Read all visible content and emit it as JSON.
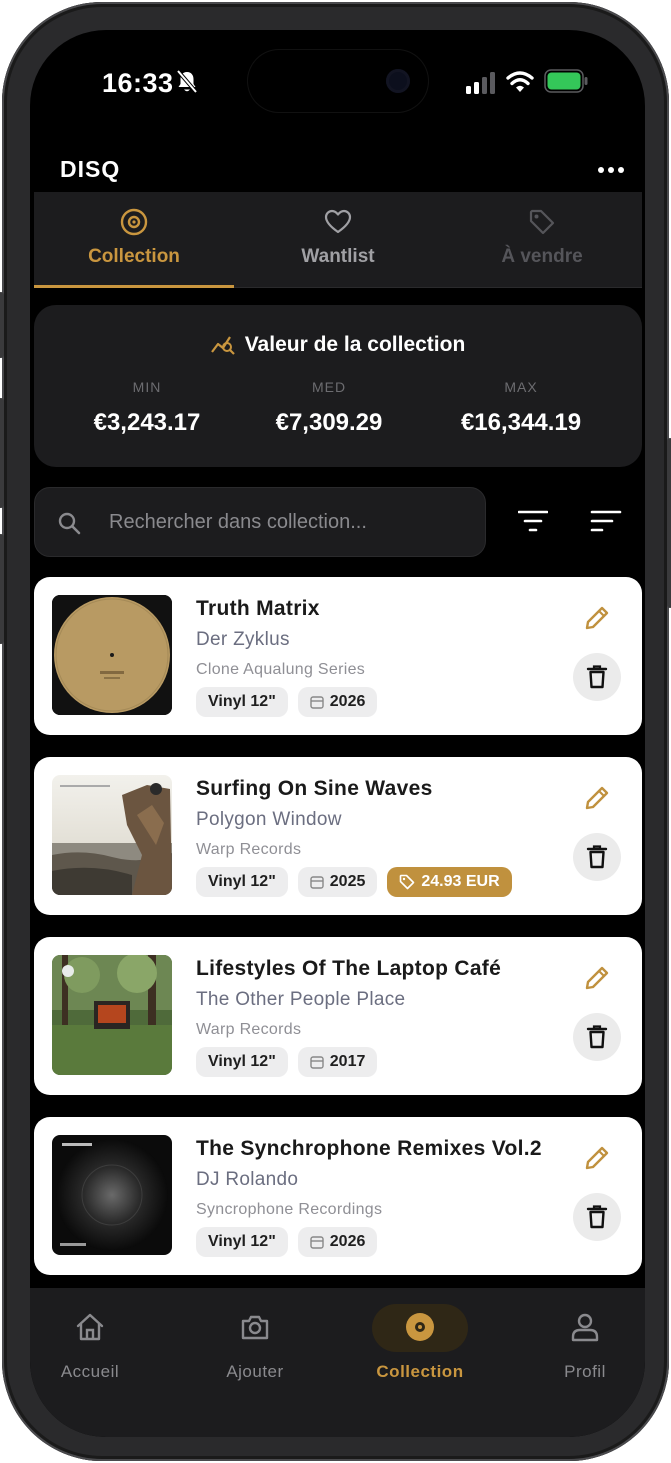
{
  "status_bar": {
    "time": "16:33"
  },
  "header": {
    "title": "DISQ"
  },
  "tabs": [
    {
      "label": "Collection",
      "icon": "vinyl-icon",
      "state": "active"
    },
    {
      "label": "Wantlist",
      "icon": "heart-icon",
      "state": "inactive"
    },
    {
      "label": "À vendre",
      "icon": "tag-icon",
      "state": "disabled"
    }
  ],
  "value_card": {
    "title": "Valeur de la collection",
    "min_label": "MIN",
    "min_value": "€3,243.17",
    "med_label": "MED",
    "med_value": "€7,309.29",
    "max_label": "MAX",
    "max_value": "€16,344.19"
  },
  "search": {
    "placeholder": "Rechercher dans collection..."
  },
  "records": [
    {
      "title": "Truth Matrix",
      "artist": "Der Zyklus",
      "label": "Clone Aqualung Series",
      "format": "Vinyl 12\"",
      "year": "2026",
      "price": ""
    },
    {
      "title": "Surfing On Sine Waves",
      "artist": "Polygon Window",
      "label": "Warp Records",
      "format": "Vinyl 12\"",
      "year": "2025",
      "price": "24.93 EUR"
    },
    {
      "title": "Lifestyles Of The Laptop Café",
      "artist": "The Other People Place",
      "label": "Warp Records",
      "format": "Vinyl 12\"",
      "year": "2017",
      "price": ""
    },
    {
      "title": "The Synchrophone Remixes Vol.2",
      "artist": "DJ Rolando",
      "label": "Syncrophone Recordings",
      "format": "Vinyl 12\"",
      "year": "2026",
      "price": ""
    }
  ],
  "bottom_nav": [
    {
      "label": "Accueil",
      "icon": "home-icon"
    },
    {
      "label": "Ajouter",
      "icon": "camera-icon"
    },
    {
      "label": "Collection",
      "icon": "vinyl-icon",
      "active": true
    },
    {
      "label": "Profil",
      "icon": "person-icon"
    }
  ],
  "colors": {
    "accent": "#c9963f",
    "background": "#000000",
    "surface": "#1c1c1e",
    "card": "#ffffff"
  }
}
